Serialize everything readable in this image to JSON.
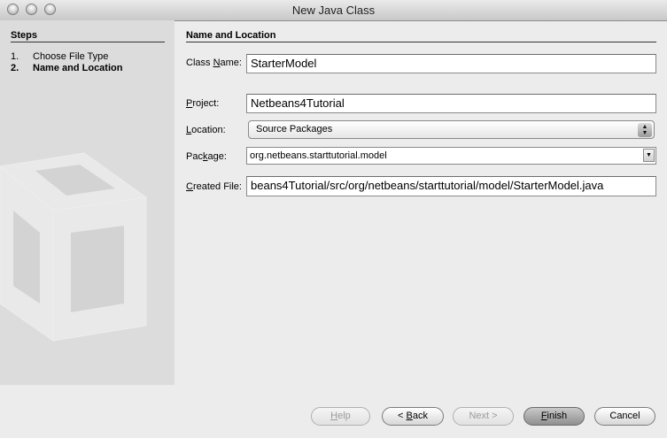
{
  "window": {
    "title": "New Java Class"
  },
  "steps": {
    "title": "Steps",
    "items": [
      {
        "num": "1.",
        "label": "Choose File Type"
      },
      {
        "num": "2.",
        "label": "Name and Location"
      }
    ]
  },
  "form": {
    "section_title": "Name and Location",
    "class_name": {
      "label_pre": "Class ",
      "label_key": "N",
      "label_post": "ame:",
      "value": "StarterModel"
    },
    "project": {
      "label_key": "P",
      "label_post": "roject:",
      "value": "Netbeans4Tutorial"
    },
    "location": {
      "label_key": "L",
      "label_post": "ocation:",
      "value": "Source Packages"
    },
    "package": {
      "label_pre": "Pac",
      "label_key": "k",
      "label_post": "age:",
      "value": "org.netbeans.starttutorial.model"
    },
    "created_file": {
      "label_key": "C",
      "label_post": "reated File:",
      "value": "beans4Tutorial/src/org/netbeans/starttutorial/model/StarterModel.java"
    }
  },
  "buttons": {
    "help": {
      "key": "H",
      "rest": "elp"
    },
    "back": {
      "pre": "< ",
      "key": "B",
      "rest": "ack"
    },
    "next": "Next >",
    "finish": {
      "key": "F",
      "rest": "inish"
    },
    "cancel": "Cancel"
  }
}
